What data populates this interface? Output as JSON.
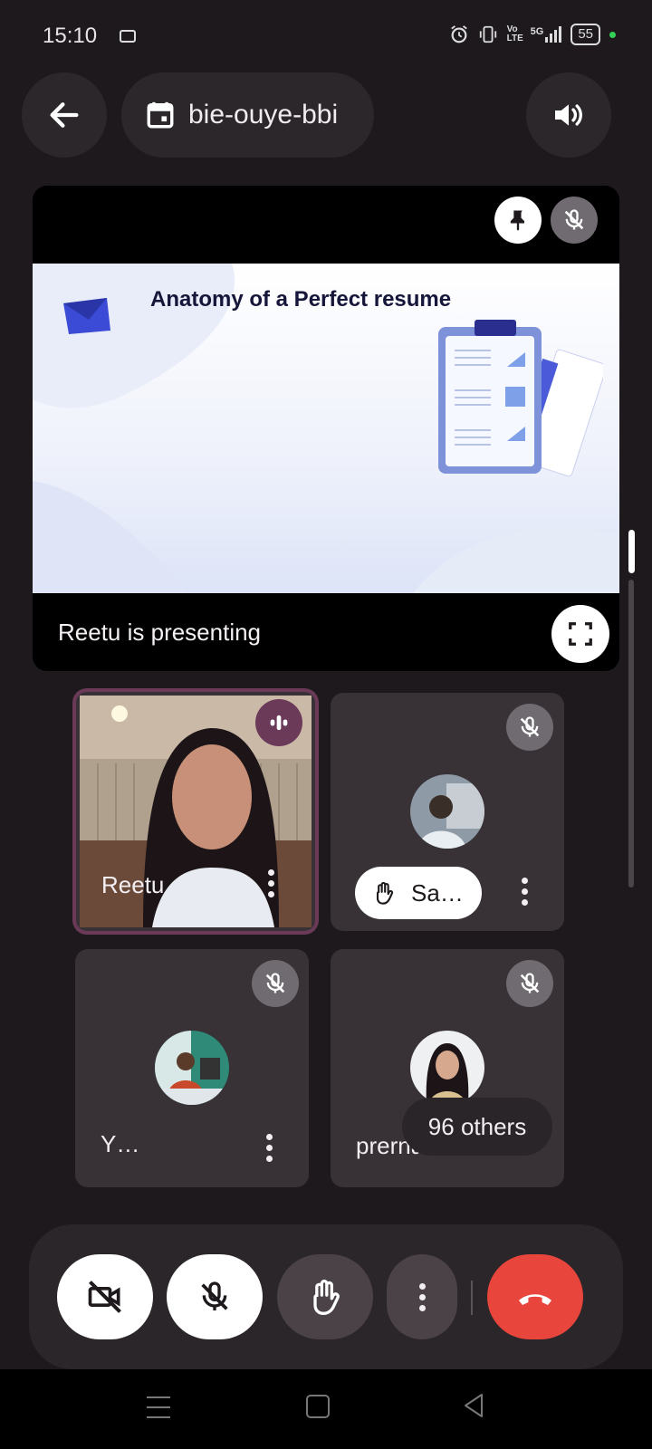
{
  "status_bar": {
    "time": "15:10",
    "battery": "55",
    "icons": [
      "video-record-icon",
      "alarm-icon",
      "vibrate-icon",
      "volte-icon",
      "5g-signal-icon",
      "battery-icon"
    ],
    "network_label": "5G",
    "volte_label": "Vo LTE"
  },
  "header": {
    "meeting_code": "bie-ouye-bbi"
  },
  "presentation": {
    "slide_title": "Anatomy of a Perfect resume",
    "status_text": "Reetu is presenting"
  },
  "participants": [
    {
      "name": "Reetu",
      "speaking": true
    },
    {
      "name": "Sa…",
      "hand_raised": true,
      "muted": true
    },
    {
      "name": "Y…",
      "muted": true
    },
    {
      "name": "prerna",
      "muted": true
    }
  ],
  "others_label": "96 others",
  "colors": {
    "background": "#1d191c",
    "tile": "#383236",
    "active_border": "#6b3a59",
    "end_call": "#e8453c"
  }
}
